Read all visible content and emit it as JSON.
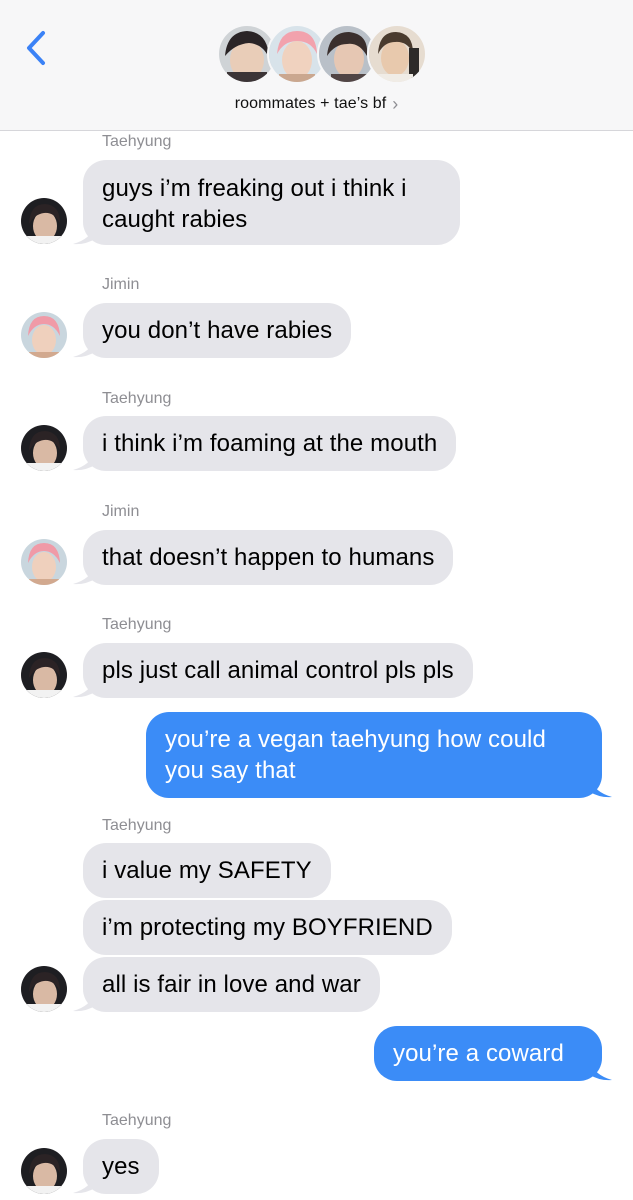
{
  "header": {
    "back_icon": "chevron-left-icon",
    "group_title": "roommates + tae’s bf",
    "chevron": "›",
    "accent_color": "#3b82f6"
  },
  "messages": [
    {
      "type": "sender",
      "text": "Taehyung"
    },
    {
      "type": "in",
      "text": "guys i’m freaking out i think i caught rabies"
    },
    {
      "type": "sender",
      "text": "Jimin"
    },
    {
      "type": "in",
      "text": "you don’t have rabies"
    },
    {
      "type": "sender",
      "text": "Taehyung"
    },
    {
      "type": "in",
      "text": "i think i’m foaming at the mouth"
    },
    {
      "type": "sender",
      "text": "Jimin"
    },
    {
      "type": "in",
      "text": "that doesn’t happen to humans"
    },
    {
      "type": "sender",
      "text": "Taehyung"
    },
    {
      "type": "in",
      "text": "pls just call animal control pls pls"
    },
    {
      "type": "out",
      "text": "you’re a vegan taehyung how could you say that"
    },
    {
      "type": "sender",
      "text": "Taehyung"
    },
    {
      "type": "in",
      "text": "i value my SAFETY"
    },
    {
      "type": "in",
      "text": "i’m protecting my BOYFRIEND"
    },
    {
      "type": "in",
      "text": "all is fair in love and war"
    },
    {
      "type": "out",
      "text": "you’re a coward"
    },
    {
      "type": "sender",
      "text": "Taehyung"
    },
    {
      "type": "in",
      "text": "yes"
    }
  ],
  "colors": {
    "incoming_bubble": "#e5e5ea",
    "outgoing_bubble": "#3b8cf7",
    "sender_name": "#8e8e93",
    "header_bg": "#f7f7f8"
  }
}
